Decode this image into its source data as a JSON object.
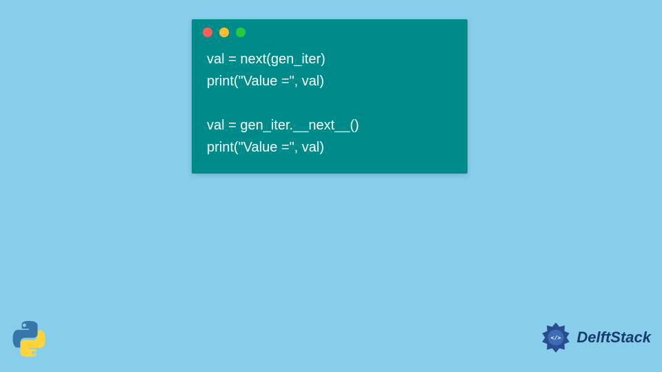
{
  "code": {
    "lines": [
      "val = next(gen_iter)",
      "print(\"Value =\", val)",
      "",
      "val = gen_iter.__next__()",
      "print(\"Value =\", val)"
    ]
  },
  "branding": {
    "site_name": "DelftStack"
  },
  "colors": {
    "background": "#87CEEB",
    "code_window": "#008B8B",
    "dot_red": "#FF5F56",
    "dot_yellow": "#FFBD2E",
    "dot_green": "#27C93F",
    "brand_text": "#1a3a6e"
  }
}
